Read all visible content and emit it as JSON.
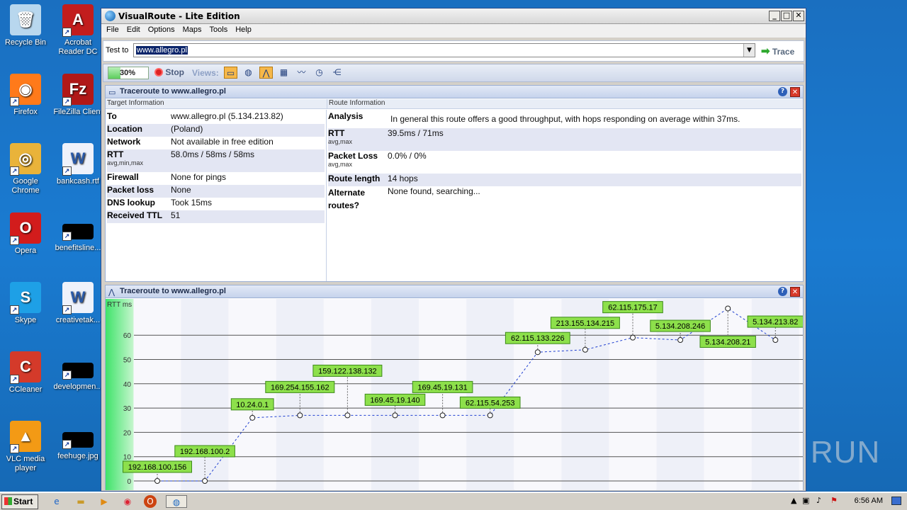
{
  "desktop": {
    "icons": [
      {
        "label": "Recycle Bin",
        "icon": "recycle-bin-icon"
      },
      {
        "label": "Acrobat Reader DC",
        "icon": "acrobat-icon"
      },
      {
        "label": "Firefox",
        "icon": "firefox-icon"
      },
      {
        "label": "FileZilla Client",
        "icon": "filezilla-icon"
      },
      {
        "label": "Google Chrome",
        "icon": "chrome-icon"
      },
      {
        "label": "bankcash.rtf",
        "icon": "word-doc-icon"
      },
      {
        "label": "Opera",
        "icon": "opera-icon"
      },
      {
        "label": "benefitsline...",
        "icon": "file-thumb-icon"
      },
      {
        "label": "Skype",
        "icon": "skype-icon"
      },
      {
        "label": "creativetak...",
        "icon": "word-doc-icon"
      },
      {
        "label": "CCleaner",
        "icon": "ccleaner-icon"
      },
      {
        "label": "developmen...",
        "icon": "file-thumb-icon"
      },
      {
        "label": "VLC media player",
        "icon": "vlc-icon"
      },
      {
        "label": "feehuge.jpg",
        "icon": "file-thumb-icon"
      }
    ]
  },
  "window": {
    "title": "VisualRoute - Lite Edition",
    "menu": [
      "File",
      "Edit",
      "Options",
      "Maps",
      "Tools",
      "Help"
    ],
    "test_to_label": "Test to",
    "test_to_value": "www.allegro.pl",
    "trace_label": "Trace",
    "progress_text": "30%",
    "progress_fraction": 0.3,
    "stop_label": "Stop",
    "views_label": "Views:"
  },
  "info_panel": {
    "title": "Traceroute to www.allegro.pl",
    "target_header": "Target Information",
    "route_header": "Route Information",
    "target_rows": [
      {
        "key": "To",
        "value": "www.allegro.pl (5.134.213.82)",
        "sub": ""
      },
      {
        "key": "Location",
        "value": "(Poland)",
        "sub": ""
      },
      {
        "key": "Network",
        "value": "Not available in free edition",
        "sub": ""
      },
      {
        "key": "RTT",
        "value": "58.0ms / 58ms / 58ms",
        "sub": "avg,min,max"
      },
      {
        "key": "Firewall",
        "value": "None for pings",
        "sub": ""
      },
      {
        "key": "Packet loss",
        "value": "None",
        "sub": ""
      },
      {
        "key": "DNS lookup",
        "value": "Took 15ms",
        "sub": ""
      },
      {
        "key": "Received TTL",
        "value": "51",
        "sub": ""
      }
    ],
    "route_rows": [
      {
        "key": "Analysis",
        "value": "In general this route offers a good throughput, with hops responding on average within 37ms.",
        "sub": ""
      },
      {
        "key": "RTT",
        "value": "39.5ms / 71ms",
        "sub": "avg,max"
      },
      {
        "key": "Packet Loss",
        "value": "0.0% / 0%",
        "sub": "avg,max"
      },
      {
        "key": "Route length",
        "value": "14 hops",
        "sub": ""
      },
      {
        "key": "Alternate routes?",
        "value": "None found, searching...",
        "sub": ""
      }
    ]
  },
  "graph_panel": {
    "title": "Traceroute to www.allegro.pl"
  },
  "chart_data": {
    "type": "line",
    "ylabel": "RTT ms",
    "ylim": [
      0,
      70
    ],
    "yticks": [
      0,
      10,
      20,
      30,
      40,
      50,
      60
    ],
    "grid": true,
    "series": [
      {
        "points": [
          {
            "label": "192.168.100.156",
            "rtt": 0
          },
          {
            "label": "192.168.100.2",
            "rtt": 0
          },
          {
            "label": "10.24.0.1",
            "rtt": 26
          },
          {
            "label": "169.254.155.162",
            "rtt": 27
          },
          {
            "label": "159.122.138.132",
            "rtt": 27
          },
          {
            "label": "169.45.19.140",
            "rtt": 27
          },
          {
            "label": "169.45.19.131",
            "rtt": 27
          },
          {
            "label": "62.115.54.253",
            "rtt": 27
          },
          {
            "label": "62.115.133.226",
            "rtt": 53
          },
          {
            "label": "213.155.134.215",
            "rtt": 54
          },
          {
            "label": "62.115.175.17",
            "rtt": 59
          },
          {
            "label": "5.134.208.246",
            "rtt": 58
          },
          {
            "label": "5.134.208.21",
            "rtt": 71
          },
          {
            "label": "5.134.213.82",
            "rtt": 58
          }
        ]
      }
    ]
  },
  "taskbar": {
    "start_label": "Start",
    "clock": "6:56 AM"
  },
  "watermark": "ANY RUN"
}
